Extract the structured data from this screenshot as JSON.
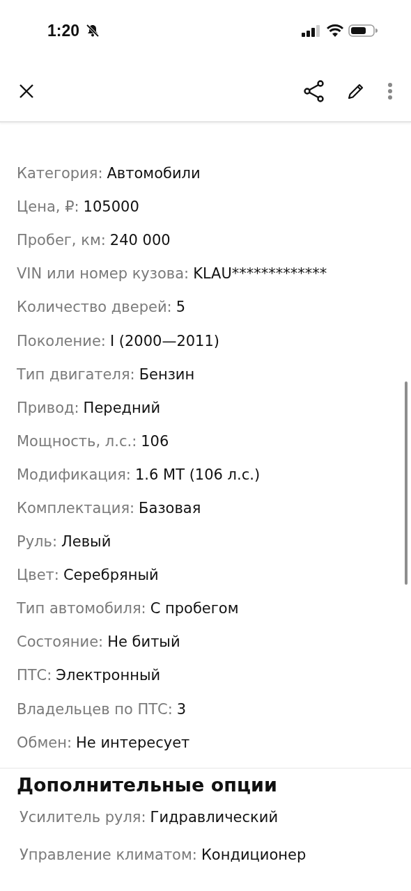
{
  "status_bar": {
    "time": "1:20"
  },
  "params": [
    {
      "label": "Категория:",
      "value": "Автомобили"
    },
    {
      "label": "Цена, ₽:",
      "value": "105000"
    },
    {
      "label": "Пробег, км:",
      "value": "240 000"
    },
    {
      "label": "VIN или номер кузова:",
      "value": "KLAU*************"
    },
    {
      "label": "Количество дверей:",
      "value": "5"
    },
    {
      "label": "Поколение:",
      "value": "I (2000—2011)"
    },
    {
      "label": "Тип двигателя:",
      "value": "Бензин"
    },
    {
      "label": "Привод:",
      "value": "Передний"
    },
    {
      "label": "Мощность, л.с.:",
      "value": "106"
    },
    {
      "label": "Модификация:",
      "value": "1.6 MT (106 л.с.)"
    },
    {
      "label": "Комплектация:",
      "value": "Базовая"
    },
    {
      "label": "Руль:",
      "value": "Левый"
    },
    {
      "label": "Цвет:",
      "value": "Серебряный"
    },
    {
      "label": "Тип автомобиля:",
      "value": "С пробегом"
    },
    {
      "label": "Состояние:",
      "value": "Не битый"
    },
    {
      "label": "ПТС:",
      "value": "Электронный"
    },
    {
      "label": "Владельцев по ПТС:",
      "value": "3"
    },
    {
      "label": "Обмен:",
      "value": "Не интересует"
    }
  ],
  "options": {
    "title": "Дополнительные опции",
    "items": [
      {
        "label": "Усилитель руля:",
        "value": "Гидравлический"
      },
      {
        "label": "Управление климатом:",
        "value": "Кондиционер"
      }
    ]
  }
}
